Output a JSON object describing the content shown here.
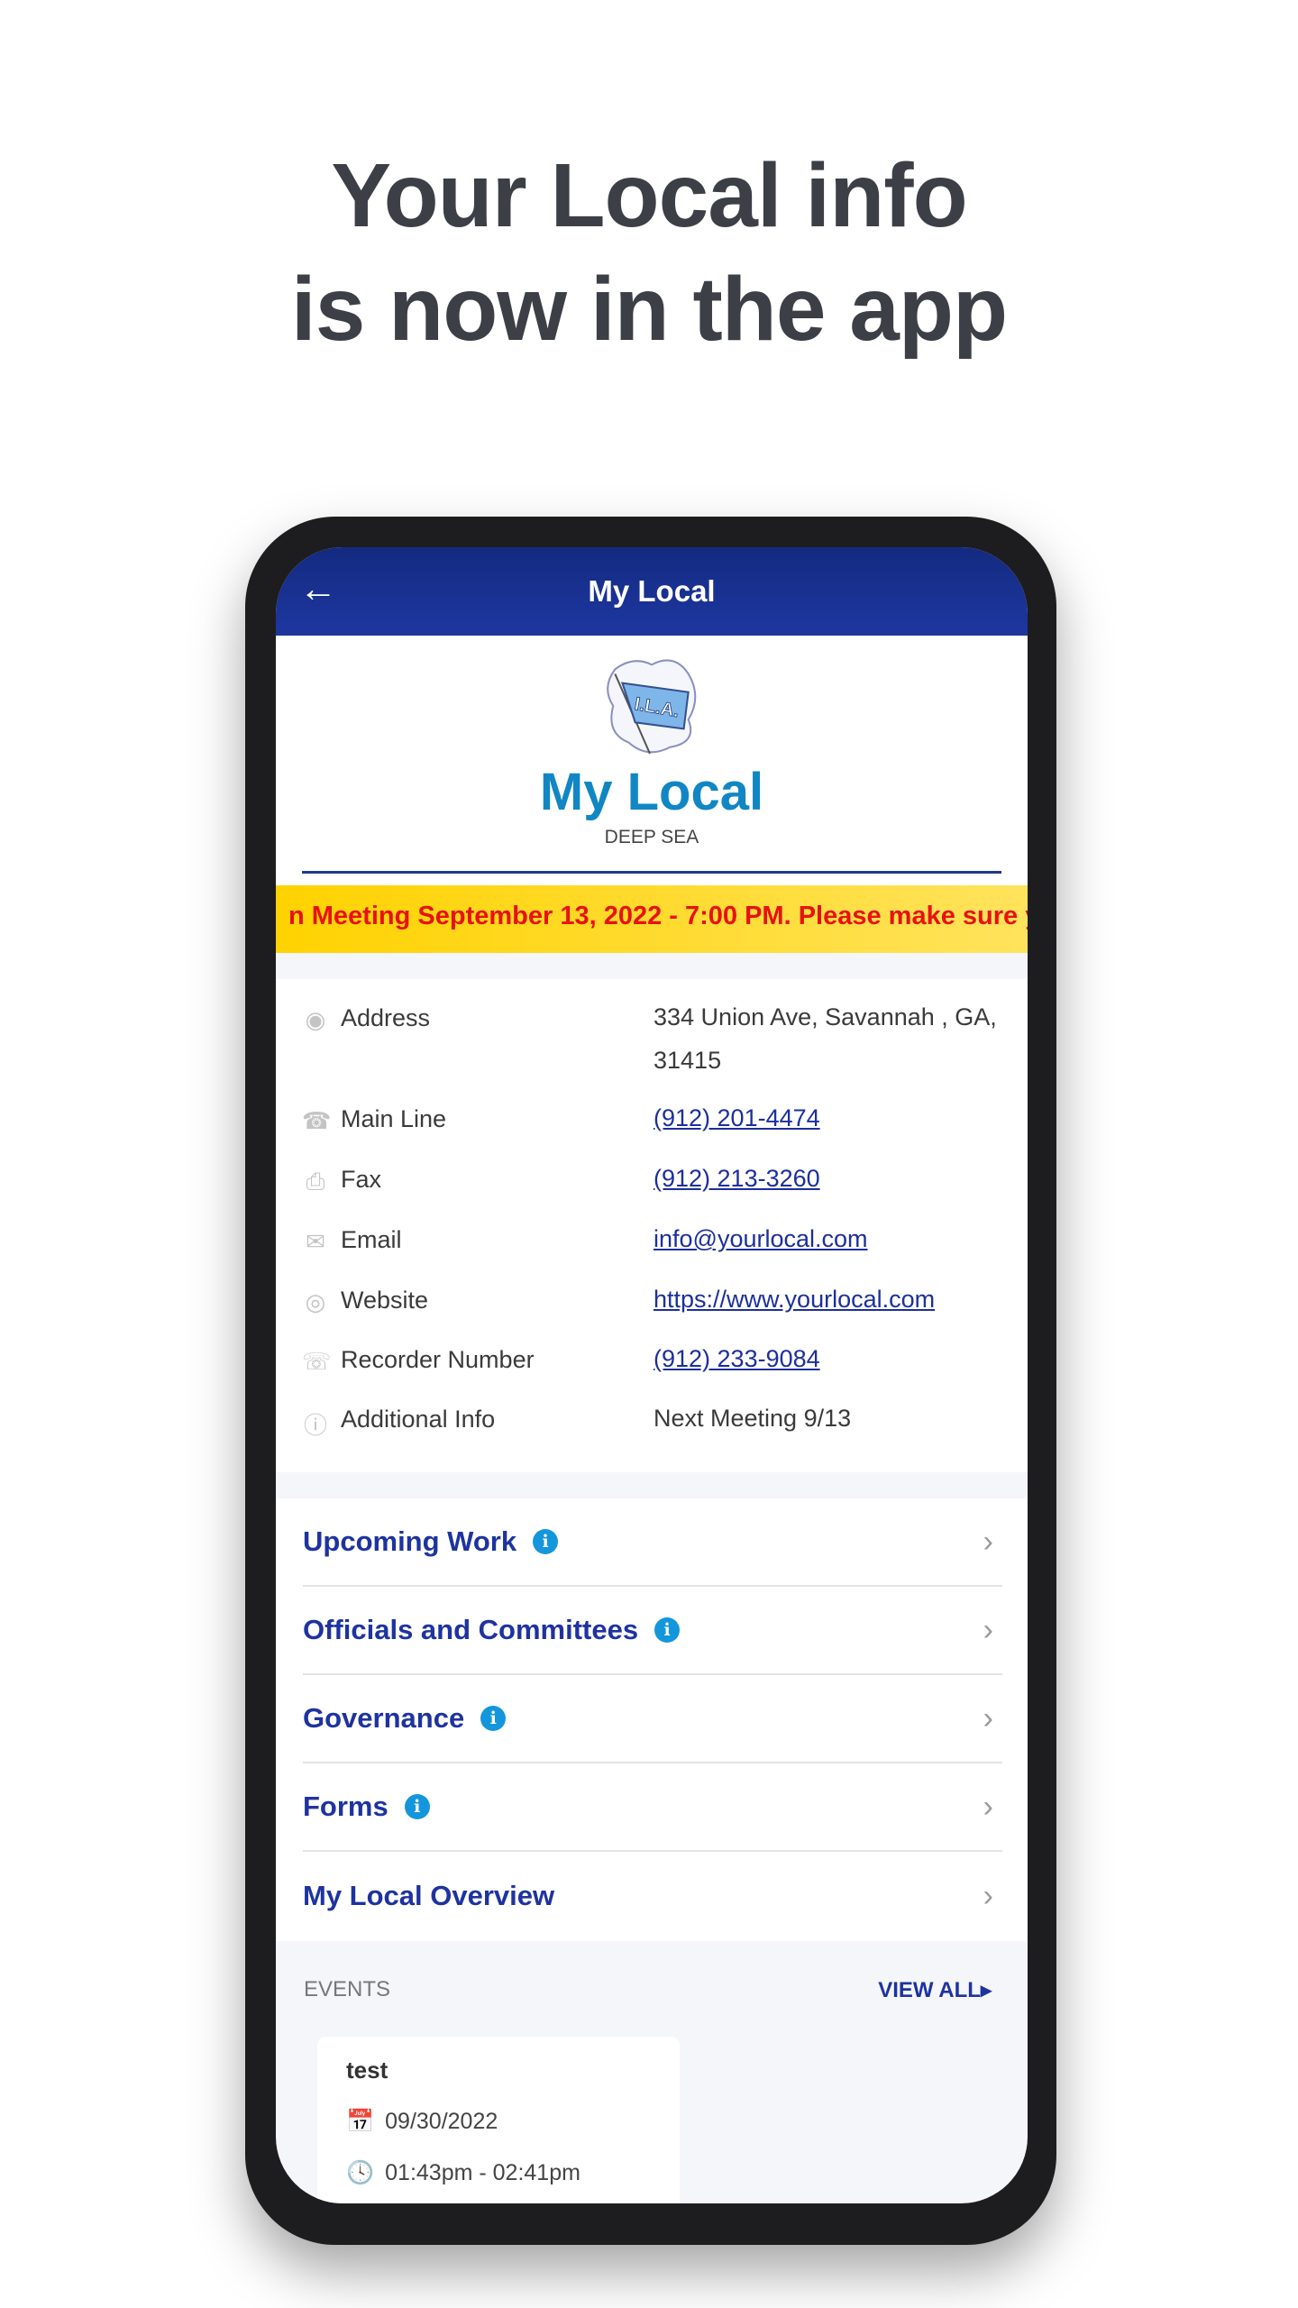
{
  "headline": {
    "line1": "Your Local info",
    "line2": "is now in the app"
  },
  "app": {
    "header": {
      "title": "My Local",
      "back_icon": "arrow-left-icon"
    },
    "local": {
      "logo_text": "I.L.A.",
      "name": "My Local",
      "subtitle": "DEEP SEA"
    },
    "banner": {
      "text": "n Meeting September 13, 2022 - 7:00 PM.  Please make sure yo"
    },
    "info": [
      {
        "icon": "location-pin-icon",
        "label": "Address",
        "value": "334 Union Ave, Savannah , GA, 31415",
        "link": false
      },
      {
        "icon": "phone-icon",
        "label": "Main Line",
        "value": "(912) 201-4474",
        "link": true
      },
      {
        "icon": "fax-icon",
        "label": "Fax",
        "value": "(912) 213-3260",
        "link": true
      },
      {
        "icon": "mail-icon",
        "label": "Email",
        "value": "info@yourlocal.com",
        "link": true
      },
      {
        "icon": "globe-icon",
        "label": "Website",
        "value": "https://www.yourlocal.com",
        "link": true
      },
      {
        "icon": "phone-record-icon",
        "label": "Recorder Number",
        "value": "(912) 233-9084",
        "link": true
      },
      {
        "icon": "info-icon",
        "label": "Additional Info",
        "value": "Next Meeting 9/13",
        "link": false
      }
    ],
    "menu": [
      {
        "label": "Upcoming Work",
        "info": true
      },
      {
        "label": "Officials and Committees",
        "info": true
      },
      {
        "label": "Governance",
        "info": true
      },
      {
        "label": "Forms",
        "info": true
      },
      {
        "label": "My Local Overview",
        "info": false
      }
    ],
    "events": {
      "heading": "EVENTS",
      "view_all": "VIEW ALL",
      "cards": [
        {
          "title": "test",
          "date": "09/30/2022",
          "time": "01:43pm - 02:41pm"
        }
      ]
    }
  },
  "colors": {
    "header": "#1d37a0",
    "accent": "#1e33a0",
    "title": "#1186c4",
    "banner": "#ffd200",
    "banner_text": "#e8110f"
  }
}
